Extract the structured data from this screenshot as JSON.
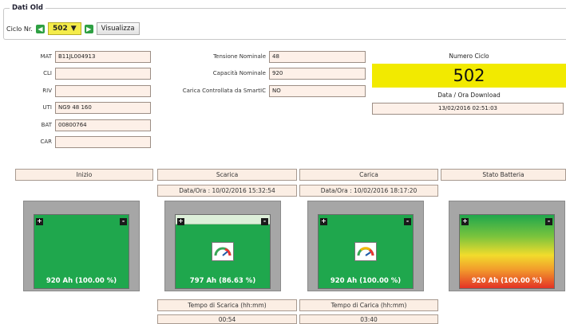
{
  "legend": "Dati Old",
  "cycle_selector": {
    "label": "Ciclo Nr.",
    "value": "502",
    "button": "Visualizza"
  },
  "identity": [
    {
      "label": "MAT",
      "value": "B11JL004913"
    },
    {
      "label": "CLI",
      "value": ""
    },
    {
      "label": "RIV",
      "value": ""
    },
    {
      "label": "UTI",
      "value": "NG9 48 160"
    },
    {
      "label": "BAT",
      "value": "00800764"
    },
    {
      "label": "CAR",
      "value": ""
    }
  ],
  "specs": [
    {
      "label": "Tensione Nominale",
      "value": "48"
    },
    {
      "label": "Capacità Nominale",
      "value": "920"
    },
    {
      "label": "Carica Controllata da SmartIC",
      "value": "NO"
    }
  ],
  "cycle_info": {
    "number_label": "Numero Ciclo",
    "number": "502",
    "download_label": "Data / Ora Download",
    "download_value": "13/02/2016 02:51:03"
  },
  "sections": {
    "inizio": {
      "title": "Inizio",
      "battery": "920 Ah (100.00 %)"
    },
    "scarica": {
      "title": "Scarica",
      "datetime": "Data/Ora : 10/02/2016 15:32:54",
      "battery": "797 Ah (86.63 %)",
      "level_percent": 86.63,
      "time_label": "Tempo di Scarica (hh:mm)",
      "time_value": "00:54"
    },
    "carica": {
      "title": "Carica",
      "datetime": "Data/Ora : 10/02/2016 18:17:20",
      "battery": "920 Ah (100.00 %)",
      "level_percent": 100,
      "time_label": "Tempo di Carica (hh:mm)",
      "time_value": "03:40"
    },
    "stato": {
      "title": "Stato Batteria",
      "battery": "920 Ah (100.00 %)"
    }
  },
  "terminals": {
    "plus": "+",
    "minus": "-"
  },
  "colors": {
    "battery_green": "#1fa74d",
    "highlight_yellow": "#f2ea00",
    "field_bg": "#fdf0e8"
  }
}
